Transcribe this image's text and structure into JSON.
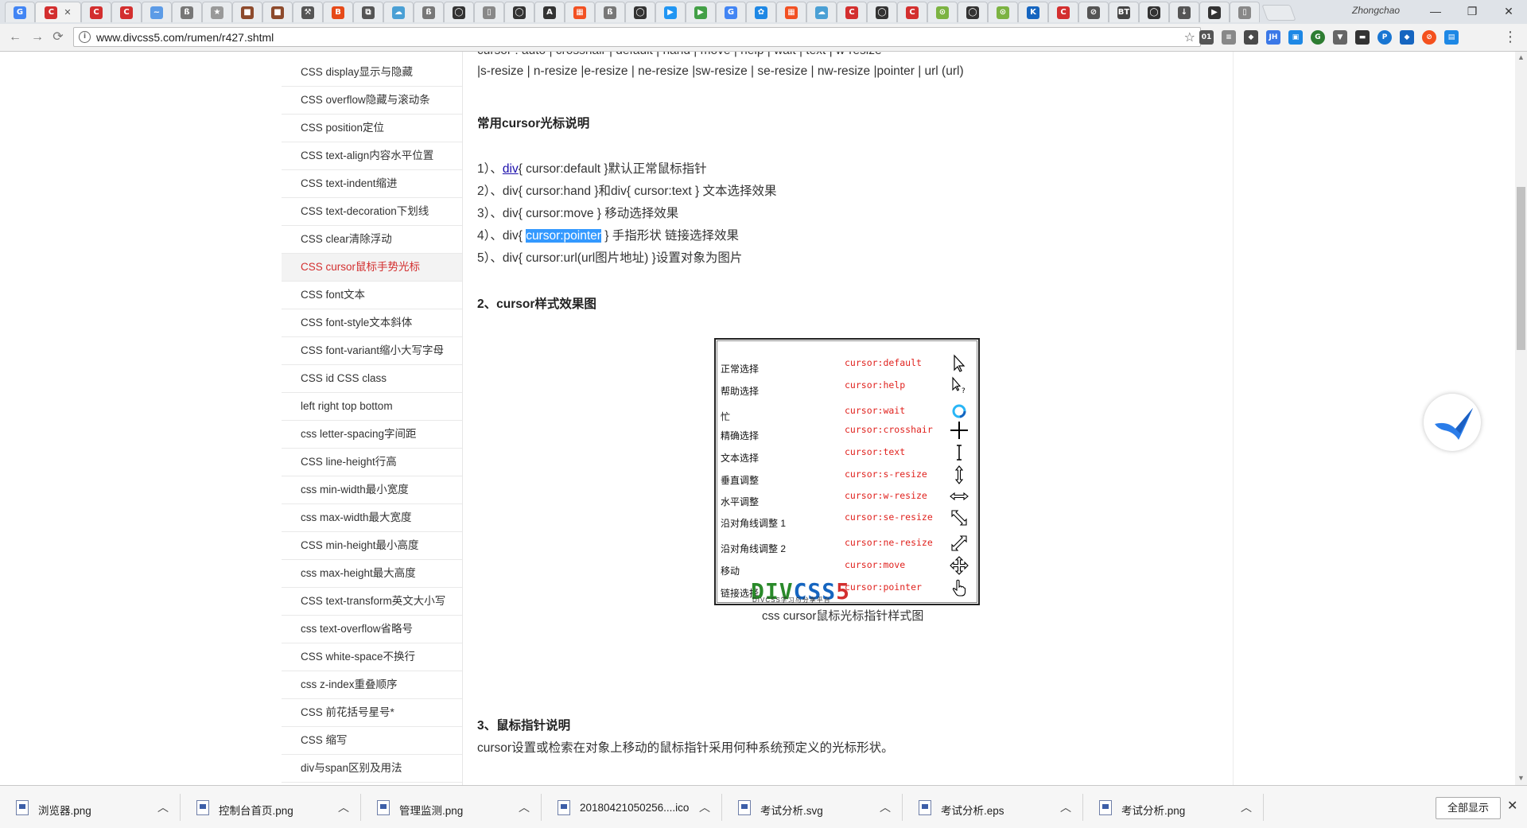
{
  "browser": {
    "profile_name": "Zhongchao",
    "url": "www.divcss5.com/rumen/r427.shtml",
    "tab_favicons": [
      "G",
      "C",
      "C",
      "C",
      "~",
      "ß",
      "★",
      "■",
      "■",
      "⚒",
      "B",
      "⧉",
      "☁",
      "ß",
      "◯",
      "▯",
      "◯",
      "A",
      "▦",
      "ß",
      "◯",
      "▶",
      "▶",
      "G",
      "✿",
      "▦",
      "☁",
      "C",
      "◯",
      "C",
      "⊙",
      "◯",
      "⊙",
      "K",
      "C",
      "⊘",
      "BT",
      "◯",
      "↓",
      "▶",
      "▯"
    ],
    "window_buttons": [
      "—",
      "❐",
      "✕"
    ]
  },
  "sidebar": {
    "items": [
      "CSS display显示与隐藏",
      "CSS overflow隐藏与滚动条",
      "CSS position定位",
      "CSS text-align内容水平位置",
      "CSS text-indent缩进",
      "CSS text-decoration下划线",
      "CSS clear清除浮动",
      "CSS cursor鼠标手势光标",
      "CSS font文本",
      "CSS font-style文本斜体",
      "CSS font-variant缩小大写字母",
      "CSS id CSS class",
      "left right top bottom",
      "css letter-spacing字间距",
      "CSS line-height行高",
      "css min-width最小宽度",
      "css max-width最大宽度",
      "CSS min-height最小高度",
      "css max-height最大高度",
      "CSS text-transform英文大小写",
      "css text-overflow省略号",
      "CSS white-space不换行",
      "css z-index重叠顺序",
      "CSS 前花括号星号*",
      "CSS 缩写",
      "div与span区别及用法"
    ],
    "active_index": 7
  },
  "article": {
    "cut_line": "cursor : auto | crosshair | default | hand | move | help | wait | text | w-resize",
    "second_line": "|s-resize | n-resize |e-resize | ne-resize |sw-resize | se-resize | nw-resize |pointer | url (url)",
    "section_common": "常用cursor光标说明",
    "list": [
      {
        "num": "1）、",
        "pre": "",
        "link": "div",
        "code": "{ cursor:default }",
        "desc": "默认正常鼠标指针"
      },
      {
        "num": "2）、",
        "pre": "div",
        "link": "",
        "code": "{ cursor:hand }和div{ cursor:text }",
        "desc": " 文本选择效果"
      },
      {
        "num": "3）、",
        "pre": "div",
        "link": "",
        "code": "{ cursor:move }",
        "desc": " 移动选择效果"
      },
      {
        "num": "4）、",
        "pre": "div",
        "link": "",
        "code": "{ cursor:pointer",
        "desc": " } 手指形状 链接选择效果"
      },
      {
        "num": "5）、",
        "pre": "div",
        "link": "",
        "code": "{ cursor:url(url图片地址) }",
        "desc": "设置对象为图片"
      }
    ],
    "item4_pre": "div{ ",
    "item4_hl": "cursor:pointer",
    "item4_post": " } 手指形状 链接选择效果",
    "section_effect": "2、cursor样式效果图",
    "figure": {
      "rows": [
        {
          "label": "正常选择",
          "value": "cursor:default",
          "icon": "arrow-cursor-icon"
        },
        {
          "label": "帮助选择",
          "value": "cursor:help",
          "icon": "help-cursor-icon"
        },
        {
          "label": "忙",
          "value": "cursor:wait",
          "icon": "wait-cursor-icon"
        },
        {
          "label": "精确选择",
          "value": "cursor:crosshair",
          "icon": "crosshair-cursor-icon"
        },
        {
          "label": "文本选择",
          "value": "cursor:text",
          "icon": "text-cursor-icon"
        },
        {
          "label": "垂直调整",
          "value": "cursor:s-resize",
          "icon": "vertical-resize-icon"
        },
        {
          "label": "水平调整",
          "value": "cursor:w-resize",
          "icon": "horizontal-resize-icon"
        },
        {
          "label": "沿对角线调整 1",
          "value": "cursor:se-resize",
          "icon": "diag-se-resize-icon"
        },
        {
          "label": "沿对角线调整 2",
          "value": "cursor:ne-resize",
          "icon": "diag-ne-resize-icon"
        },
        {
          "label": "移动",
          "value": "cursor:move",
          "icon": "move-cursor-icon"
        },
        {
          "label": "链接选择",
          "value": "cursor:pointer",
          "icon": "hand-pointer-icon"
        }
      ],
      "logo_a": "DIV",
      "logo_b": "CSS",
      "logo_c": "5",
      "logo_sub": "DIVCSS学习与分享平台"
    },
    "caption": "css cursor鼠标光标指针样式图",
    "section_desc": "3、鼠标指针说明",
    "desc": "cursor设置或检索在对象上移动的鼠标指针采用何种系统预定义的光标形状。"
  },
  "downloads": {
    "items": [
      "浏览器.png",
      "控制台首页.png",
      "管理监测.png",
      "20180421050256....ico",
      "考试分析.svg",
      "考试分析.eps",
      "考试分析.png"
    ],
    "show_all": "全部显示"
  }
}
